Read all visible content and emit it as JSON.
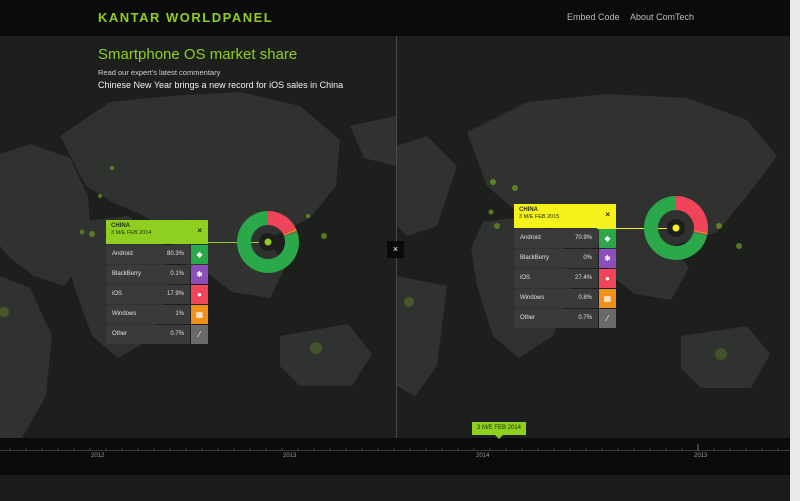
{
  "header": {
    "logo": "KANTAR WORLDPANEL",
    "nav": [
      "Embed Code",
      "About ComTech"
    ]
  },
  "page": {
    "title": "Smartphone OS market share",
    "subtitle": "Read our expert's latest commentary",
    "commentary": "Chinese New Year brings a new record for iOS sales in China"
  },
  "left_card": {
    "region": "CHINA",
    "period": "3 M/E FEB 2014",
    "close": "×",
    "rows": [
      {
        "name": "Android",
        "value": "80.3%",
        "icon": "android-icon"
      },
      {
        "name": "BlackBerry",
        "value": "0.1%",
        "icon": "blackberry-icon"
      },
      {
        "name": "iOS",
        "value": "17.9%",
        "icon": "apple-icon"
      },
      {
        "name": "Windows",
        "value": "1%",
        "icon": "windows-icon"
      },
      {
        "name": "Other",
        "value": "0.7%",
        "icon": "other-icon"
      }
    ]
  },
  "right_card": {
    "region": "CHINA",
    "period": "3 M/E FEB 2015",
    "close": "×",
    "rows": [
      {
        "name": "Android",
        "value": "70.9%",
        "icon": "android-icon"
      },
      {
        "name": "BlackBerry",
        "value": "0%",
        "icon": "blackberry-icon"
      },
      {
        "name": "iOS",
        "value": "27.4%",
        "icon": "apple-icon"
      },
      {
        "name": "Windows",
        "value": "0.8%",
        "icon": "windows-icon"
      },
      {
        "name": "Other",
        "value": "0.7%",
        "icon": "other-icon"
      }
    ]
  },
  "donut_left": {
    "android": 80.3,
    "blackberry": 0.1,
    "ios": 17.9,
    "windows": 1,
    "other": 0.7
  },
  "donut_right": {
    "android": 70.9,
    "blackberry": 0,
    "ios": 27.4,
    "windows": 0.8,
    "other": 0.7
  },
  "colors": {
    "accent": "#8fcf1f",
    "highlight": "#f4f21a",
    "android": "#2aa84a",
    "blackberry": "#8a4fb8",
    "ios": "#f0445a",
    "windows": "#f0901a",
    "other": "#6a6a6a"
  },
  "center_button": "×",
  "timeline": {
    "years": [
      "2012",
      "2013",
      "2014",
      "2013"
    ],
    "marker": "3 M/E FEB 2014"
  }
}
